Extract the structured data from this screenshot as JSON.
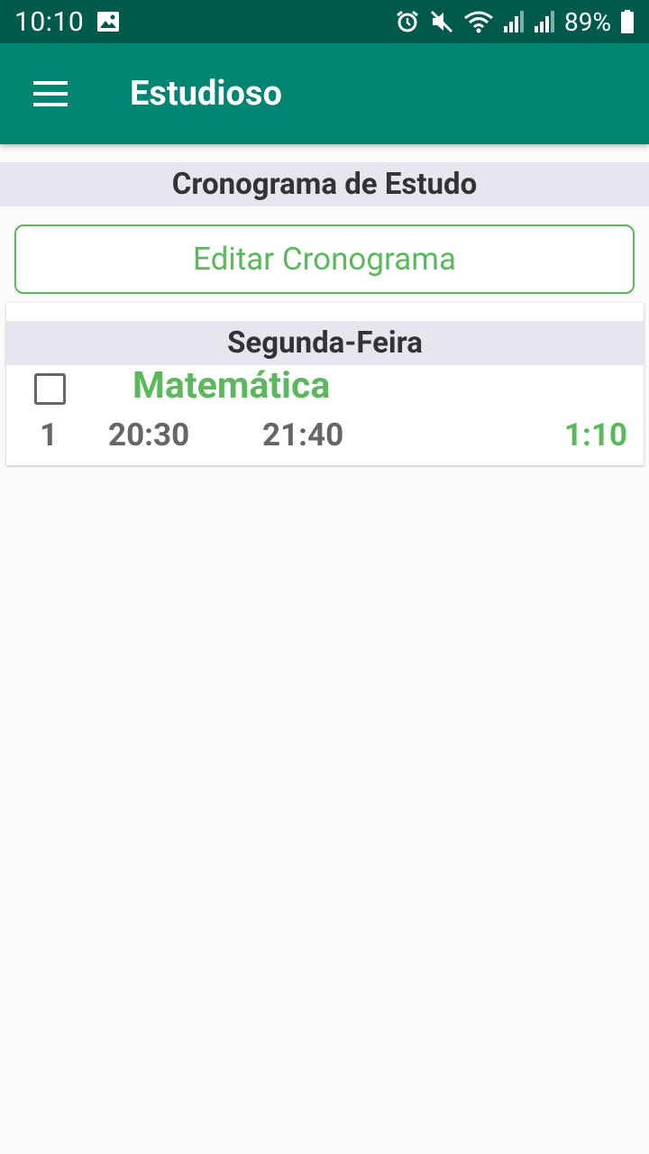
{
  "status_bar": {
    "time": "10:10",
    "battery": "89%",
    "icons": [
      "image-icon",
      "alarm-icon",
      "mute-icon",
      "wifi-icon",
      "signal-icon",
      "signal-icon",
      "battery-icon"
    ]
  },
  "app_bar": {
    "title": "Estudioso",
    "menu_icon": "hamburger-menu-icon"
  },
  "schedule": {
    "title": "Cronograma de Estudo",
    "edit_button": "Editar Cronograma",
    "days": [
      {
        "name": "Segunda-Feira",
        "items": [
          {
            "subject": "Matemática",
            "number": "1",
            "start": "20:30",
            "end": "21:40",
            "duration": "1:10",
            "checked": false
          }
        ]
      }
    ]
  },
  "colors": {
    "status_bar": "#005a4c",
    "app_bar": "#008572",
    "accent_green": "#5cb85c",
    "header_bg": "#e6e6ef",
    "text_dark": "#333333",
    "text_gray": "#666666"
  }
}
